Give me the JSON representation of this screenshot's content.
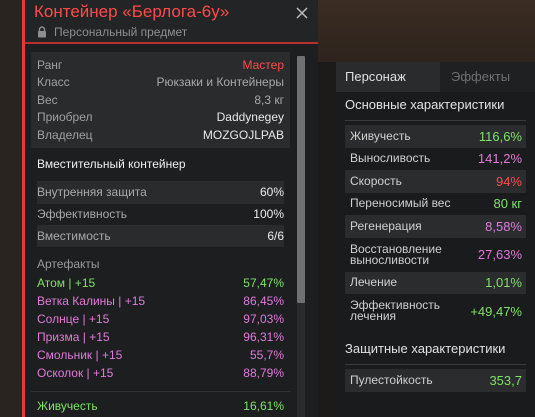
{
  "tooltip": {
    "title": "Контейнер «Берлога-6у»",
    "subtitle": "Персональный предмет",
    "accent_color": "#e33a3a",
    "info": [
      {
        "key": "Ранг",
        "value": "Мастер",
        "tone": "red"
      },
      {
        "key": "Класс",
        "value": "Рюкзаки и Контейнеры",
        "tone": "grey"
      },
      {
        "key": "Вес",
        "value": "8,3 кг",
        "tone": "grey"
      },
      {
        "key": "Приобрел",
        "value": "Daddynegey",
        "tone": "white"
      },
      {
        "key": "Владелец",
        "value": "MOZGOJLPAB",
        "tone": "white"
      }
    ],
    "type_label": "Вместительный контейнер",
    "props": [
      {
        "key": "Внутренняя защита",
        "value": "60%"
      },
      {
        "key": "Эффективность",
        "value": "100%"
      },
      {
        "key": "Вместимость",
        "value": "6/6"
      }
    ],
    "artifacts_header": "Артефакты",
    "artifacts": [
      {
        "name": "Атом | +15",
        "value": "57,47%",
        "color": "green"
      },
      {
        "name": "Ветка Калины | +15",
        "value": "86,45%",
        "color": "pink"
      },
      {
        "name": "Солнце | +15",
        "value": "97,03%",
        "color": "pink"
      },
      {
        "name": "Призма | +15",
        "value": "96,31%",
        "color": "pink"
      },
      {
        "name": "Смольник | +15",
        "value": "55,7%",
        "color": "pink"
      },
      {
        "name": "Осколок | +15",
        "value": "88,79%",
        "color": "pink"
      }
    ],
    "bonus": [
      {
        "key": "Живучесть",
        "value": "16,61%"
      }
    ]
  },
  "right_panel": {
    "tabs": [
      "Персонаж",
      "Эффекты"
    ],
    "section_main": "Основные характеристики",
    "stats": [
      {
        "label": "Живучесть",
        "value": "116,6%",
        "color": "#7fe16a"
      },
      {
        "label": "Выносливость",
        "value": "141,2%",
        "color": "#e07adb"
      },
      {
        "label": "Скорость",
        "value": "94%",
        "color": "#ff4a4a"
      },
      {
        "label": "Переносимый вес",
        "value": "80 кг",
        "color": "#7fe16a"
      },
      {
        "label": "Регенерация",
        "value": "8,58%",
        "color": "#e07adb"
      },
      {
        "label": "Восстановление выносливости",
        "value": "27,63%",
        "color": "#e07adb",
        "tall": true
      },
      {
        "label": "Лечение",
        "value": "1,01%",
        "color": "#7fe16a"
      },
      {
        "label": "Эффективность лечения",
        "value": "+49,47%",
        "color": "#7fe16a",
        "tall": true
      }
    ],
    "section_defense": "Защитные характеристики",
    "defense": [
      {
        "label": "Пулестойкость",
        "value": "353,7",
        "color": "#7fe16a"
      }
    ]
  }
}
